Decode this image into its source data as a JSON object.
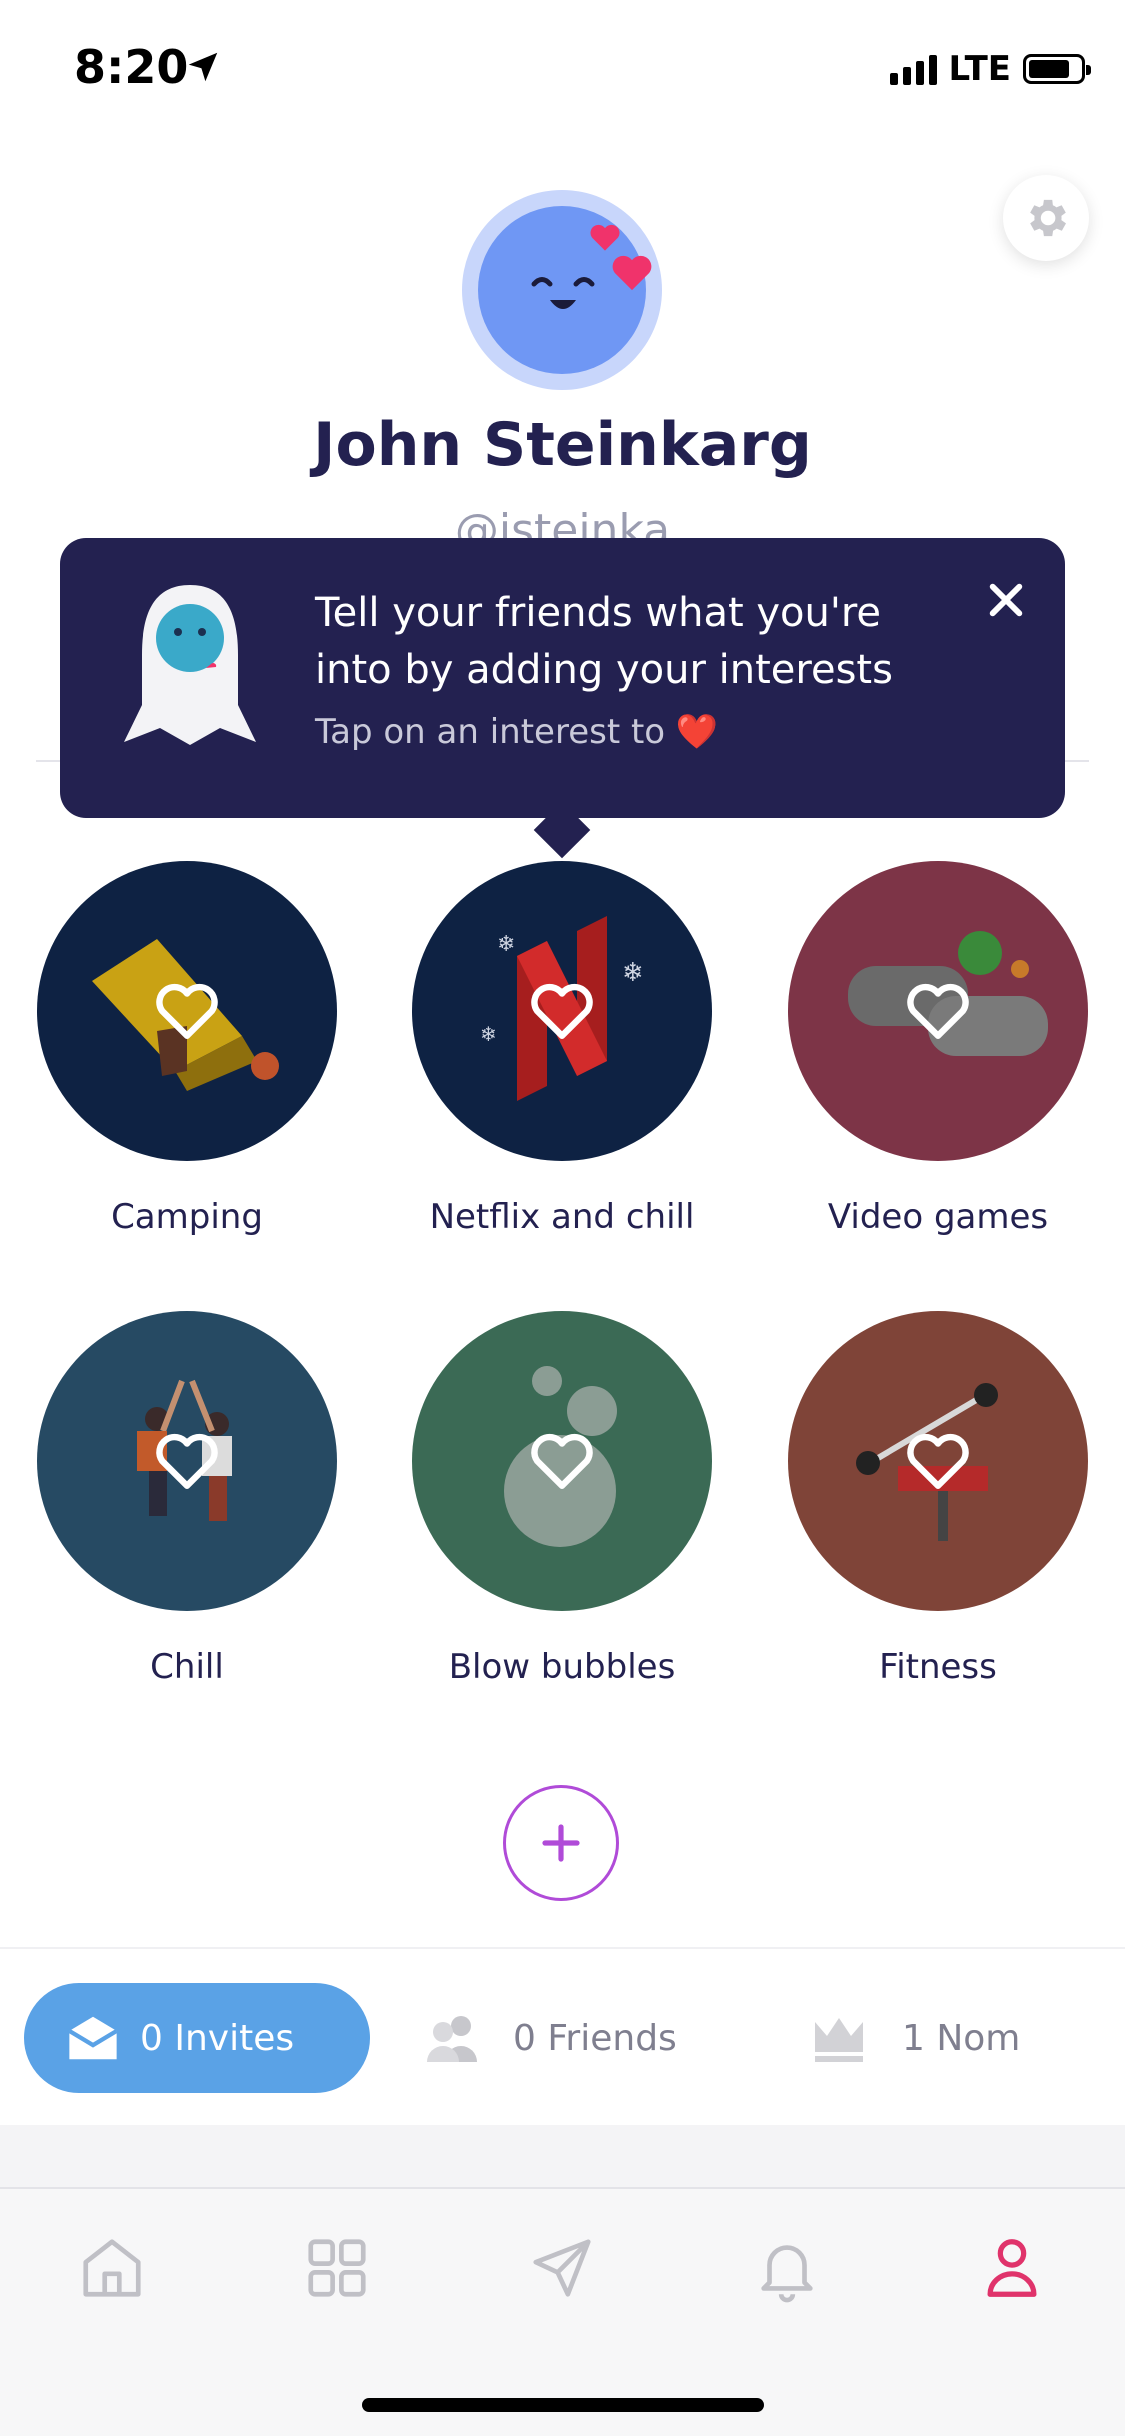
{
  "status": {
    "time": "8:20",
    "network": "LTE"
  },
  "profile": {
    "name": "John Steinkarg",
    "handle": "@jsteinka"
  },
  "tooltip": {
    "title": "Tell your friends what you're into by adding your interests",
    "subtitle": "Tap on an interest to ❤️"
  },
  "interests": [
    {
      "label": "Camping",
      "color": "#0e2243"
    },
    {
      "label": "Netflix and chill",
      "color": "#0e2243"
    },
    {
      "label": "Video games",
      "color": "#7d3447"
    },
    {
      "label": "Chill",
      "color": "#264a63"
    },
    {
      "label": "Blow bubbles",
      "color": "#3b6a55"
    },
    {
      "label": "Fitness",
      "color": "#7f4438"
    }
  ],
  "stats": {
    "invites": "0 Invites",
    "friends": "0 Friends",
    "noms": "1 Nom"
  },
  "tabs": [
    "home-icon",
    "grid-icon",
    "send-icon",
    "bell-icon",
    "profile-icon"
  ],
  "colors": {
    "accent": "#e0336b",
    "pill": "#5aa2e6",
    "navy": "#232150",
    "add": "#b04bd8"
  }
}
